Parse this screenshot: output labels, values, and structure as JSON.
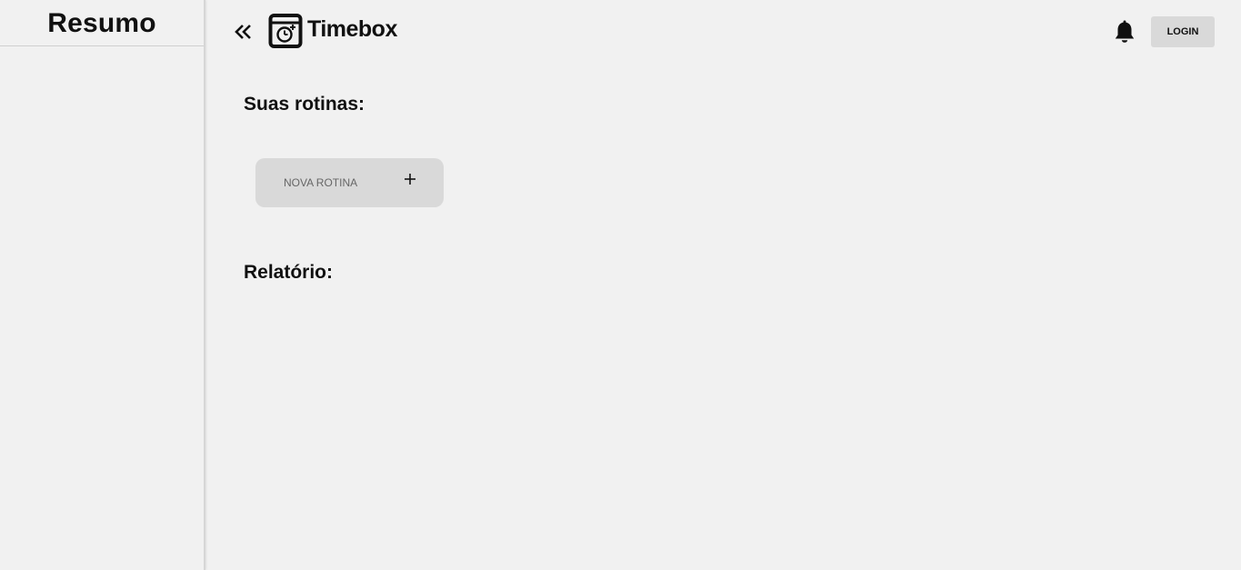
{
  "sidebar": {
    "title": "Resumo"
  },
  "header": {
    "collapse_icon": "double-chevron-left-icon",
    "logo_icon": "calendar-clock-icon",
    "brand": "Timebox",
    "notification_icon": "bell-icon",
    "login_label": "LOGIN"
  },
  "main": {
    "routines_title": "Suas rotinas:",
    "new_routine_label": "NOVA ROTINA",
    "new_routine_icon": "plus-icon",
    "report_title": "Relatório:"
  },
  "colors": {
    "background": "#f1f1f1",
    "button_bg": "#d9d9d9",
    "text": "#111111",
    "muted_text": "#666666"
  }
}
